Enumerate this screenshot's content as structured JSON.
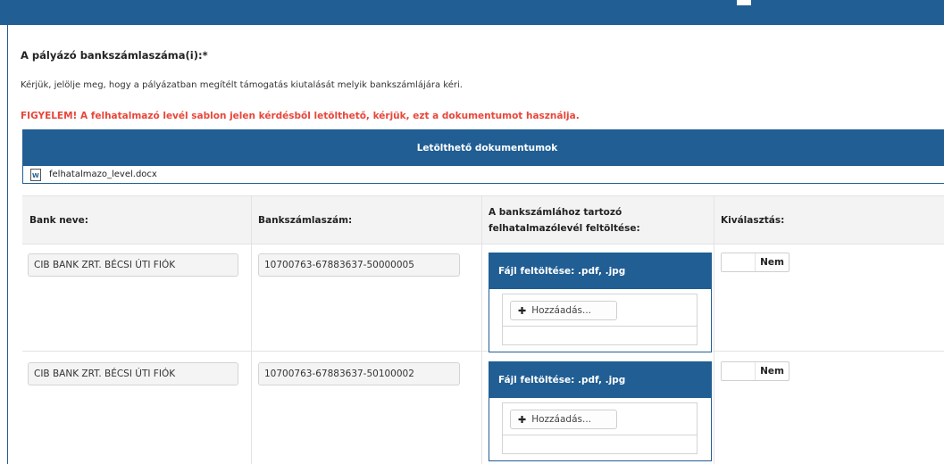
{
  "section": {
    "title": "A pályázó bankszámlaszáma(i):*",
    "instruction": "Kérjük, jelölje meg, hogy a pályázatban megítélt támogatás kiutalását melyik bankszámlájára kéri.",
    "warning": "FIGYELEM! A felhatalmazó levél sablon jelen kérdésből letölthető, kérjük, ezt a dokumentumot használja."
  },
  "documents": {
    "header": "Letölthető dokumentumok",
    "items": [
      {
        "name": "felhatalmazo_level.docx",
        "icon": "word-file-icon"
      }
    ]
  },
  "table": {
    "headers": {
      "bank": "Bank neve:",
      "account": "Bankszámlaszám:",
      "upload_line1": "A bankszámlához tartozó",
      "upload_line2": "felhatalmazólevél feltöltése:",
      "select": "Kiválasztás:"
    },
    "rows": [
      {
        "bank": "CIB BANK ZRT. BÉCSI ÚTI FIÓK",
        "account": "10700763-67883637-50000005",
        "upload_title": "Fájl feltöltése: .pdf, .jpg",
        "add_label": "Hozzáadás...",
        "toggle_label": "Nem"
      },
      {
        "bank": "CIB BANK ZRT. BÉCSI ÚTI FIÓK",
        "account": "10700763-67883637-50100002",
        "upload_title": "Fájl feltöltése: .pdf, .jpg",
        "add_label": "Hozzáadás...",
        "toggle_label": "Nem"
      }
    ]
  },
  "colors": {
    "primary": "#205e94",
    "warning": "#e8463a",
    "header_bg": "#f3f3f3"
  }
}
